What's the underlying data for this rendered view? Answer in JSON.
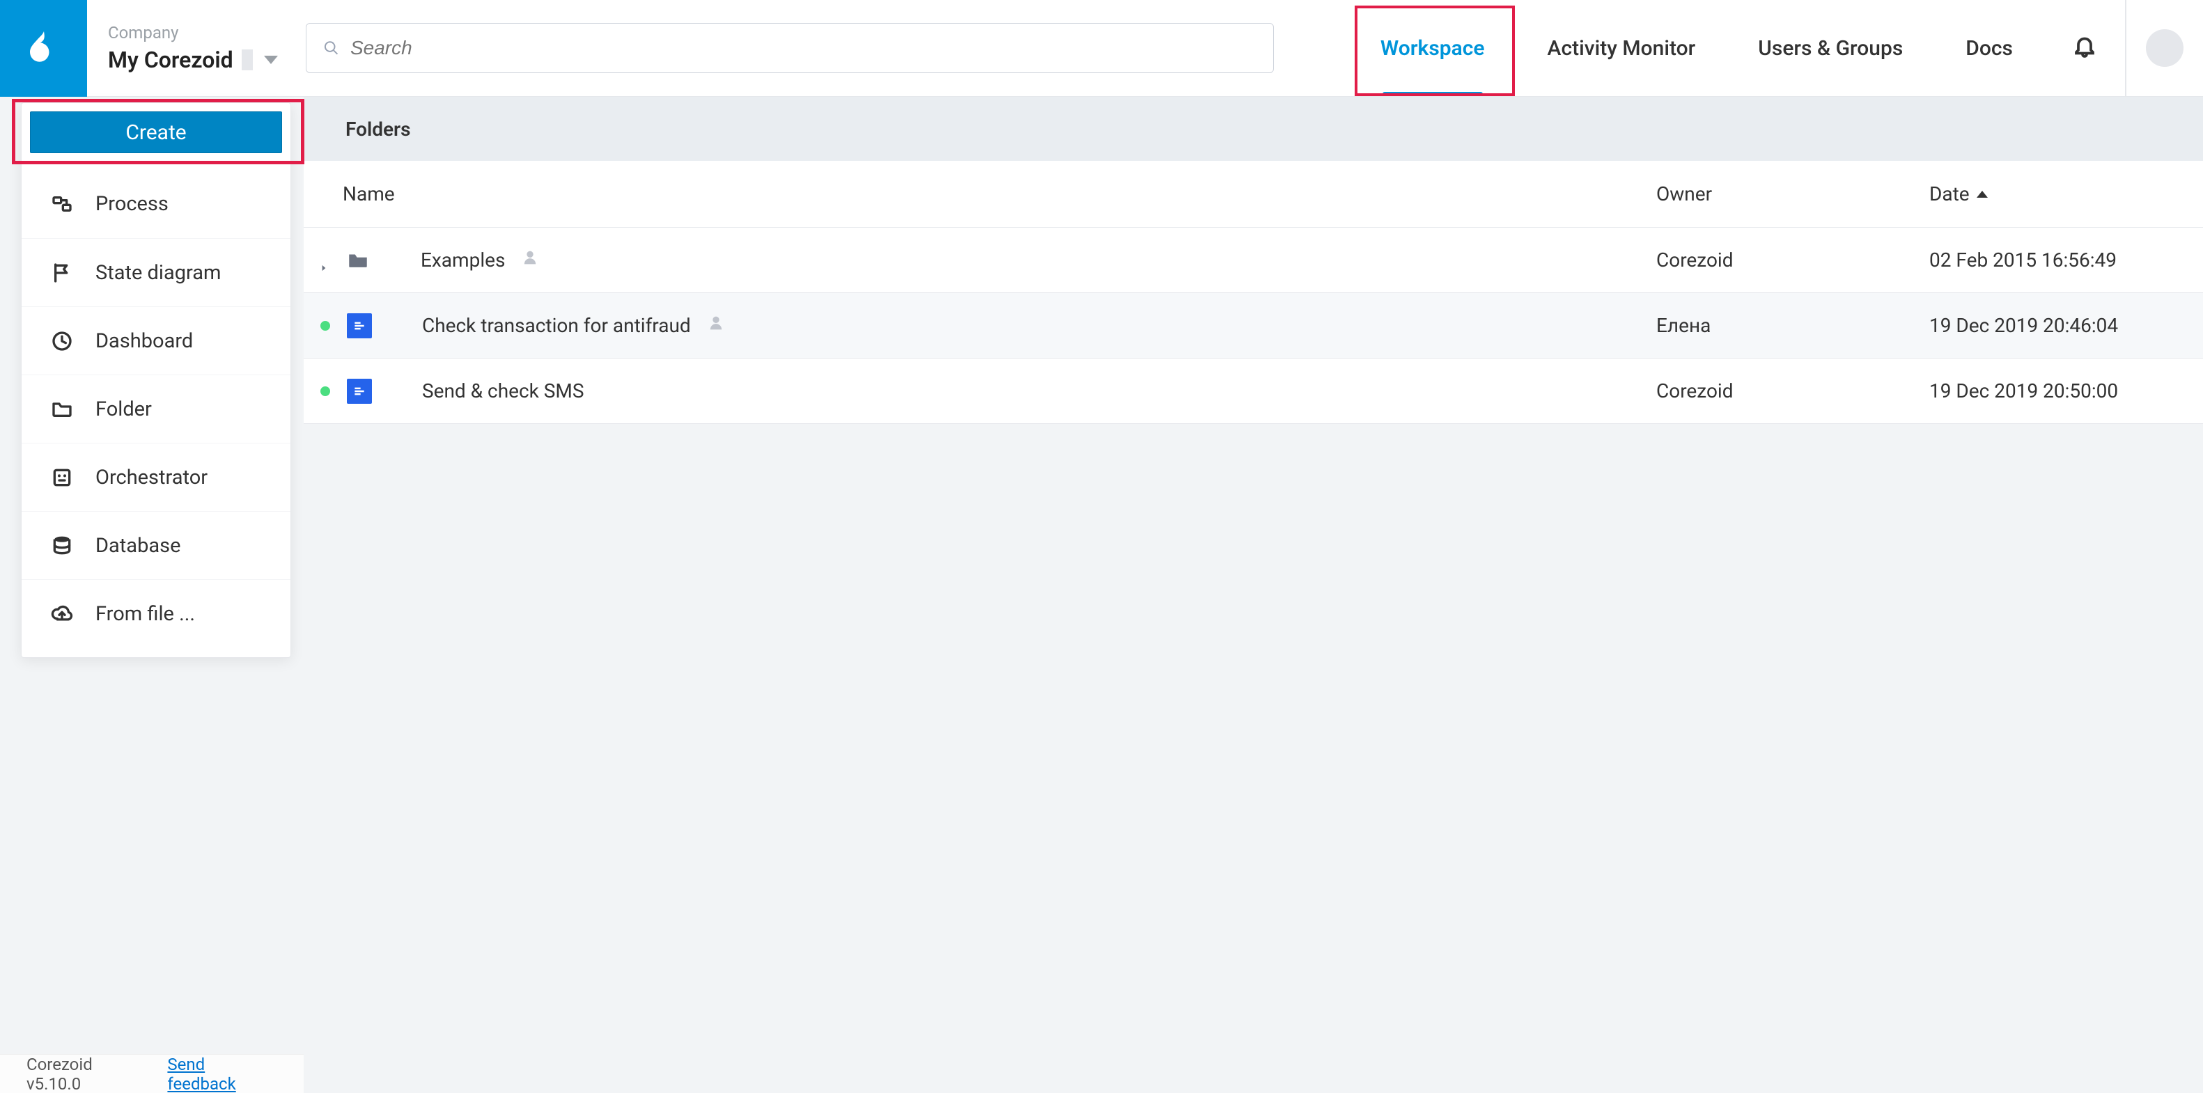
{
  "header": {
    "company_label": "Company",
    "company_name": "My Corezoid",
    "search_placeholder": "Search"
  },
  "nav": {
    "workspace": "Workspace",
    "activity_monitor": "Activity Monitor",
    "users_groups": "Users & Groups",
    "docs": "Docs"
  },
  "create_menu": {
    "button": "Create",
    "items": [
      "Process",
      "State diagram",
      "Dashboard",
      "Folder",
      "Orchestrator",
      "Database",
      "From file ..."
    ]
  },
  "table": {
    "section_title": "Folders",
    "cols": {
      "name": "Name",
      "owner": "Owner",
      "date": "Date"
    },
    "rows": [
      {
        "type": "folder",
        "dot": false,
        "name": "Examples",
        "owner": "Corezoid",
        "date": "02 Feb 2015 16:56:49"
      },
      {
        "type": "proc",
        "dot": true,
        "name": "Check transaction for antifraud",
        "owner": "Елена",
        "date": "19 Dec 2019 20:46:04",
        "hover": true
      },
      {
        "type": "proc",
        "dot": true,
        "name": "Send & check SMS",
        "owner": "Corezoid",
        "date": "19 Dec 2019 20:50:00"
      }
    ]
  },
  "footer": {
    "version": "Corezoid v5.10.0",
    "feedback": "Send feedback"
  }
}
